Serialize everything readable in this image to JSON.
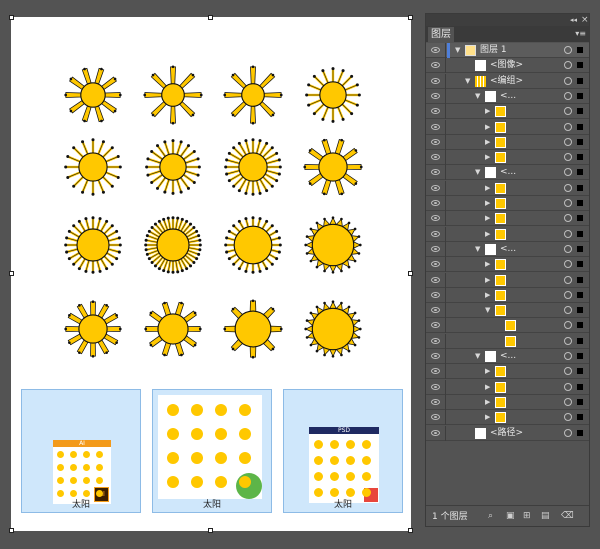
{
  "canvas": {
    "thumbnails": [
      {
        "caption": "太阳",
        "badge": "AI",
        "header": "AI"
      },
      {
        "caption": "太阳",
        "badge": "",
        "header": ""
      },
      {
        "caption": "太阳",
        "badge": "",
        "header": "PSD"
      }
    ],
    "colors": {
      "sun": "#ffc800",
      "outline": "#111111",
      "artboard": "#ffffff"
    }
  },
  "layers_panel": {
    "tab": "图层",
    "collapse_glyph": "◂◂",
    "close_glyph": "×",
    "menu_glyph": "▾≡",
    "rows": [
      {
        "name": "图层 1",
        "indent": 0,
        "expanded": true,
        "thumb": "layer",
        "highlight": true
      },
      {
        "name": "<图像>",
        "indent": 1,
        "expanded": null,
        "thumb": "white"
      },
      {
        "name": "<编组>",
        "indent": 1,
        "expanded": true,
        "thumb": "grid"
      },
      {
        "name": "<...",
        "indent": 2,
        "expanded": true,
        "thumb": "white"
      },
      {
        "name": "",
        "indent": 3,
        "expanded": false,
        "thumb": "sun"
      },
      {
        "name": "",
        "indent": 3,
        "expanded": false,
        "thumb": "sun"
      },
      {
        "name": "",
        "indent": 3,
        "expanded": false,
        "thumb": "sun"
      },
      {
        "name": "",
        "indent": 3,
        "expanded": false,
        "thumb": "sun"
      },
      {
        "name": "<...",
        "indent": 2,
        "expanded": true,
        "thumb": "white"
      },
      {
        "name": "",
        "indent": 3,
        "expanded": false,
        "thumb": "sun"
      },
      {
        "name": "",
        "indent": 3,
        "expanded": false,
        "thumb": "sun"
      },
      {
        "name": "",
        "indent": 3,
        "expanded": false,
        "thumb": "sun"
      },
      {
        "name": "",
        "indent": 3,
        "expanded": false,
        "thumb": "sun"
      },
      {
        "name": "<...",
        "indent": 2,
        "expanded": true,
        "thumb": "white"
      },
      {
        "name": "",
        "indent": 3,
        "expanded": false,
        "thumb": "sun"
      },
      {
        "name": "",
        "indent": 3,
        "expanded": false,
        "thumb": "sun"
      },
      {
        "name": "",
        "indent": 3,
        "expanded": false,
        "thumb": "sun"
      },
      {
        "name": "",
        "indent": 3,
        "expanded": true,
        "thumb": "sun"
      },
      {
        "name": "",
        "indent": 4,
        "expanded": null,
        "thumb": "sun"
      },
      {
        "name": "",
        "indent": 4,
        "expanded": null,
        "thumb": "sun"
      },
      {
        "name": "<...",
        "indent": 2,
        "expanded": true,
        "thumb": "white"
      },
      {
        "name": "",
        "indent": 3,
        "expanded": false,
        "thumb": "sun"
      },
      {
        "name": "",
        "indent": 3,
        "expanded": false,
        "thumb": "sun"
      },
      {
        "name": "",
        "indent": 3,
        "expanded": false,
        "thumb": "sun"
      },
      {
        "name": "",
        "indent": 3,
        "expanded": false,
        "thumb": "sun"
      },
      {
        "name": "<路径>",
        "indent": 1,
        "expanded": null,
        "thumb": "white"
      }
    ],
    "footer": {
      "count_label": "1 个图层"
    },
    "icons": [
      "search-icon",
      "clip-mask-icon",
      "new-sublayer-icon",
      "new-layer-icon",
      "delete-icon"
    ]
  }
}
